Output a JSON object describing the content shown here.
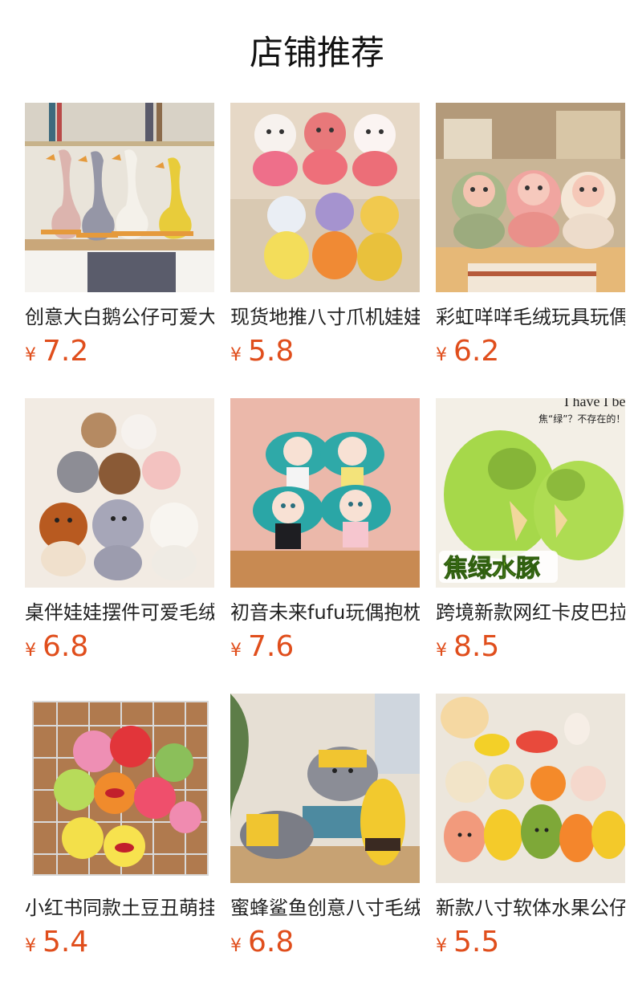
{
  "page": {
    "title": "店铺推荐"
  },
  "products": [
    {
      "name": "创意大白鹅公仔可爱大鹅毛绒玩具",
      "currency": "¥",
      "price": "7.2",
      "image": "white-goose-plush-image"
    },
    {
      "name": "现货地推八寸爪机娃娃水果公仔",
      "currency": "¥",
      "price": "5.8",
      "image": "fruit-plush-dolls-image"
    },
    {
      "name": "彩虹咩咩毛绒玩具玩偶公仔",
      "currency": "¥",
      "price": "6.2",
      "image": "sheep-plush-image"
    },
    {
      "name": "桌伴娃娃摆件可爱毛绒公仔",
      "currency": "¥",
      "price": "6.8",
      "image": "animal-plush-set-image"
    },
    {
      "name": "初音未来fufu玩偶抱枕公仔",
      "currency": "¥",
      "price": "7.6",
      "image": "miku-fufu-plush-image"
    },
    {
      "name": "跨境新款网红卡皮巴拉毛绒公仔",
      "currency": "¥",
      "price": "8.5",
      "image": "capybara-plush-image"
    },
    {
      "name": "小红书同款土豆丑萌挂件公仔",
      "currency": "¥",
      "price": "5.4",
      "image": "ugly-cute-pendant-image"
    },
    {
      "name": "蜜蜂鲨鱼创意八寸毛绒公仔",
      "currency": "¥",
      "price": "6.8",
      "image": "bee-shark-plush-image"
    },
    {
      "name": "新款八寸软体水果公仔玩偶",
      "currency": "¥",
      "price": "5.5",
      "image": "soft-fruit-plush-image"
    }
  ],
  "image_texts": {
    "capybara_badge": "焦绿水豚",
    "capybara_bubble": "焦“绿”？不存在的！",
    "capybara_bg_text": "I have I be"
  },
  "colors": {
    "price": "#e04e1c",
    "title": "#111111",
    "name": "#222222"
  }
}
